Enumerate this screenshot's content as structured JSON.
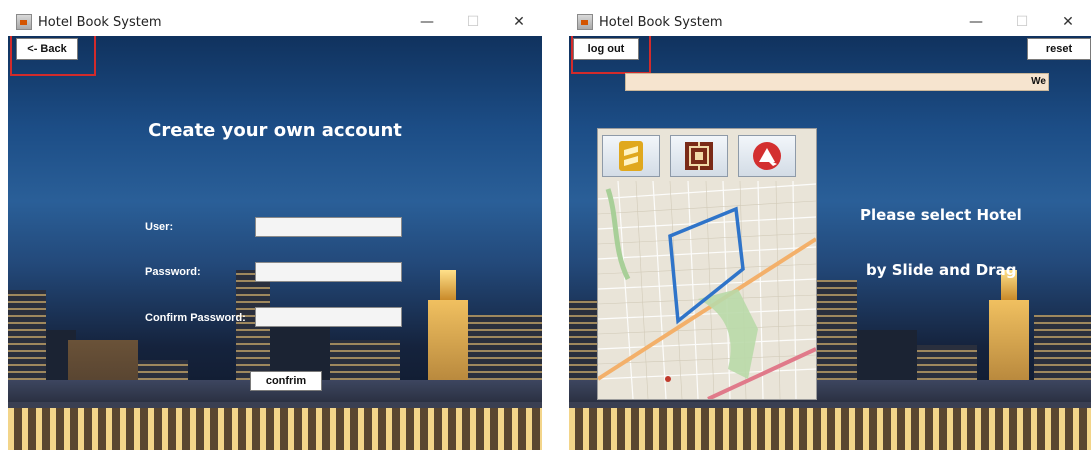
{
  "left_window": {
    "title": "Hotel Book System",
    "controls": {
      "minimize": "—",
      "maximize": "☐",
      "close": "✕"
    },
    "back_label": "<- Back",
    "heading": "Create your own account",
    "user_label": "User:",
    "password_label": "Password:",
    "confirm_password_label": "Confirm Password:",
    "user_value": "",
    "password_value": "",
    "confirm_password_value": "",
    "confirm_label": "confrim"
  },
  "right_window": {
    "title": "Hotel Book System",
    "controls": {
      "minimize": "—",
      "maximize": "☐",
      "close": "✕"
    },
    "logout_label": "log out",
    "reset_label": "reset",
    "welcome_text": "We",
    "prompt_line1": "Please select Hotel",
    "prompt_line2": "by Slide and Drag",
    "hotel_buttons": [
      "hotel-brand-1-icon",
      "hotel-brand-2-icon",
      "hotel-brand-3-icon"
    ]
  },
  "colors": {
    "highlight": "#d22b2b",
    "welcome_bar": "#f6e4cf",
    "route": "#2f74c9"
  }
}
